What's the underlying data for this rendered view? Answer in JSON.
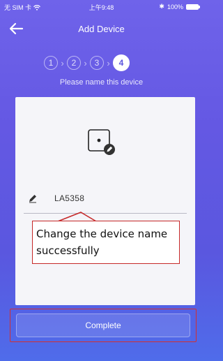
{
  "status_bar": {
    "carrier": "无 SIM 卡",
    "time": "上午9:48",
    "battery": "100%"
  },
  "nav": {
    "title": "Add Device"
  },
  "steps": {
    "items": [
      "1",
      "2",
      "3",
      "4"
    ],
    "active": "4",
    "caption": "Please name this device"
  },
  "device": {
    "name_value": "LA5358"
  },
  "annotation": {
    "text": "Change the device name successfully",
    "color": "#c62828"
  },
  "footer": {
    "complete_label": "Complete"
  },
  "colors": {
    "background_top": "#6f63ea",
    "background_bottom": "#4f6cea",
    "card": "#f5f5f9"
  }
}
